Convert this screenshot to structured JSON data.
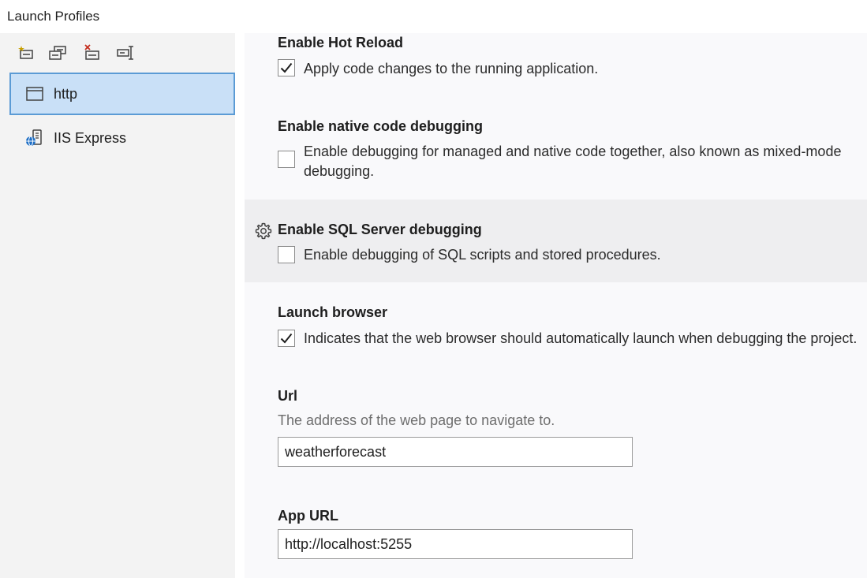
{
  "window": {
    "title": "Launch Profiles"
  },
  "toolbar": {
    "buttons": [
      {
        "icon": "new-profile-icon"
      },
      {
        "icon": "copy-profile-icon"
      },
      {
        "icon": "delete-profile-icon"
      },
      {
        "icon": "rename-profile-icon"
      }
    ]
  },
  "profiles": [
    {
      "label": "http",
      "icon": "window-icon",
      "selected": true
    },
    {
      "label": "IIS Express",
      "icon": "iis-express-icon",
      "selected": false
    }
  ],
  "settings": {
    "hot_reload": {
      "heading": "Enable Hot Reload",
      "checkbox_label": "Apply code changes to the running application.",
      "checked": true
    },
    "native_debugging": {
      "heading": "Enable native code debugging",
      "checkbox_label_line1": "Enable debugging for managed and native code together, also known as mixed-mode",
      "checkbox_label_line2": "debugging.",
      "checked": false
    },
    "sql_debugging": {
      "heading": "Enable SQL Server debugging",
      "checkbox_label": "Enable debugging of SQL scripts and stored procedures.",
      "checked": false
    },
    "launch_browser": {
      "heading": "Launch browser",
      "checkbox_label": "Indicates that the web browser should automatically launch when debugging the project.",
      "checked": true
    },
    "url": {
      "heading": "Url",
      "description": "The address of the web page to navigate to.",
      "value": "weatherforecast"
    },
    "app_url": {
      "heading": "App URL",
      "value": "http://localhost:5255"
    }
  }
}
